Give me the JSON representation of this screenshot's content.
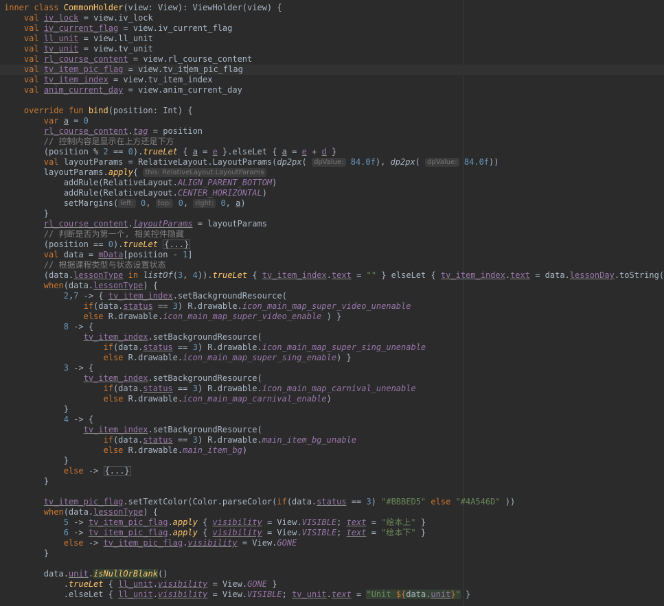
{
  "code": {
    "l1": {
      "a": "inner class ",
      "b": "CommonHolder",
      "c": "(view: View): ViewHolder(view) {"
    },
    "l2": {
      "a": "val ",
      "b": "iv_lock",
      "c": " = view.iv_lock"
    },
    "l3": {
      "a": "val ",
      "b": "iv_current_flag",
      "c": " = view.iv_current_flag"
    },
    "l4": {
      "a": "val ",
      "b": "ll_unit",
      "c": " = view.ll_unit"
    },
    "l5": {
      "a": "val ",
      "b": "tv_unit",
      "c": " = view.tv_unit"
    },
    "l6": {
      "a": "val ",
      "b": "rl_course_content",
      "c": " = view.rl_course_content"
    },
    "l7": {
      "a": "val ",
      "b": "tv_item_pic_flag",
      "c": " = view.tv_it",
      "d": "em_pic_flag"
    },
    "l8": {
      "a": "val ",
      "b": "tv_item_index",
      "c": " = view.tv_item_index"
    },
    "l9": {
      "a": "val ",
      "b": "anim_current_day",
      "c": " = view.anim_current_day"
    },
    "l11": {
      "a": "override fun ",
      "b": "bind",
      "c": "(position: Int) {"
    },
    "l12": {
      "a": "var ",
      "b": "a",
      "c": " = ",
      "d": "0"
    },
    "l13": {
      "a": "rl_course_content",
      "b": ".",
      "c": "tag",
      "d": " = position"
    },
    "l14": {
      "a": "// 控制内容是显示在上方还是下方"
    },
    "l15": {
      "a": "(position % ",
      "b": "2",
      "c": " == ",
      "d": "0",
      "e": ").",
      "f": "trueLet",
      "g": " { ",
      "h": "a",
      "i": " = ",
      "j": "e",
      "k": " }.elseLet { ",
      "l": "a",
      "m": " = ",
      "n": "e",
      "o": " + ",
      "p": "d",
      "q": " }"
    },
    "l16": {
      "a": "val ",
      "b": "layoutParams = RelativeLayout.LayoutParams(",
      "c": "dp2px",
      "d": "(",
      "e": "dpValue:",
      "f": " 84.0f",
      "g": "), ",
      "h": "dp2px",
      "i": "(",
      "j": "dpValue:",
      "k": " 84.0f",
      "l": "))"
    },
    "l17": {
      "a": "layoutParams.",
      "b": "apply",
      "c": "{",
      "d": "this: RelativeLayout.LayoutParams"
    },
    "l18": {
      "a": "addRule(RelativeLayout.",
      "b": "ALIGN_PARENT_BOTTOM",
      "c": ")"
    },
    "l19": {
      "a": "addRule(RelativeLayout.",
      "b": "CENTER_HORIZONTAL",
      "c": ")"
    },
    "l20": {
      "a": "setMargins(",
      "b": "left:",
      "c": " 0",
      "d": ", ",
      "e": "top:",
      "f": " 0",
      "g": ", ",
      "h": "right:",
      "i": " 0",
      "j": ", ",
      "k": "a",
      "l": ")"
    },
    "l21": {
      "a": "}"
    },
    "l22": {
      "a": "rl_course_content",
      "b": ".",
      "c": "layoutParams",
      "d": " = layoutParams"
    },
    "l23": {
      "a": "// 判断是否为第一个, 相关控件隐藏"
    },
    "l24": {
      "a": "(position == ",
      "b": "0",
      "c": ").",
      "d": "trueLet",
      "e": " ",
      "f": "{...}"
    },
    "l25": {
      "a": "val ",
      "b": "data = ",
      "c": "mData",
      "d": "[position - ",
      "e": "1",
      "f": "]"
    },
    "l26": {
      "a": "// 根据课程类型与状态设置状态"
    },
    "l27": {
      "a": "(data.",
      "b": "lessonType",
      "c": " ",
      "d": "in ",
      "e": "listOf",
      "f": "(",
      "g": "3",
      "h": ", ",
      "i": "4",
      "j": ")).",
      "k": "trueLet",
      "l": " { ",
      "m": "tv_item_index",
      "n": ".",
      "o": "text",
      "p": " = ",
      "q": "\"\"",
      "r": " } elseLet { ",
      "s": "tv_item_index",
      "t": ".",
      "u": "text",
      "v": " = data.",
      "w": "lessonDay",
      "x": ".toString() }"
    },
    "l28": {
      "a": "when",
      "b": "(data.",
      "c": "lessonType",
      "d": ") {"
    },
    "l29": {
      "a": "2",
      "b": ",",
      "c": "7",
      "d": " -> { ",
      "e": "tv_item_index",
      "f": ".setBackgroundResource("
    },
    "l30": {
      "a": "if",
      "b": "(data.",
      "c": "status",
      "d": " == ",
      "e": "3",
      "f": ") R.drawable.",
      "g": "icon_main_map_super_video_unenable"
    },
    "l31": {
      "a": "else ",
      "b": "R.drawable.",
      "c": "icon_main_map_super_video_enable",
      "d": " ) }"
    },
    "l32": {
      "a": "8",
      "b": " -> {"
    },
    "l33": {
      "a": "tv_item_index",
      "b": ".setBackgroundResource("
    },
    "l34": {
      "a": "if",
      "b": "(data.",
      "c": "status",
      "d": " == ",
      "e": "3",
      "f": ") R.drawable.",
      "g": "icon_main_map_super_sing_unenable"
    },
    "l35": {
      "a": "else ",
      "b": "R.drawable.",
      "c": "icon_main_map_super_sing_enable",
      "d": ") }"
    },
    "l36": {
      "a": "3",
      "b": " -> {"
    },
    "l37": {
      "a": "tv_item_index",
      "b": ".setBackgroundResource("
    },
    "l38": {
      "a": "if",
      "b": "(data.",
      "c": "status",
      "d": " == ",
      "e": "3",
      "f": ") R.drawable.",
      "g": "icon_main_map_carnival_unenable"
    },
    "l39": {
      "a": "else ",
      "b": "R.drawable.",
      "c": "icon_main_map_carnival_enable",
      "d": ")"
    },
    "l40": {
      "a": "}"
    },
    "l41": {
      "a": "4",
      "b": " -> {"
    },
    "l42": {
      "a": "tv_item_index",
      "b": ".setBackgroundResource("
    },
    "l43": {
      "a": "if",
      "b": "(data.",
      "c": "status",
      "d": " == ",
      "e": "3",
      "f": ") R.drawable.",
      "g": "main_item_bg_unable"
    },
    "l44": {
      "a": "else ",
      "b": "R.drawable.",
      "c": "main_item_bg",
      "d": ")"
    },
    "l45": {
      "a": "}"
    },
    "l46": {
      "a": "else",
      "b": " -> ",
      "c": "{...}"
    },
    "l47": {
      "a": "}"
    },
    "l49": {
      "a": "tv_item_pic_flag",
      "b": ".setTextColor(Color.parseColor(",
      "c": "if",
      "d": "(data.",
      "e": "status",
      "f": " == ",
      "g": "3",
      "h": ") ",
      "i": "\"#BBBED5\"",
      "j": " ",
      "k": "else ",
      "l": "\"#4A546D\"",
      "m": " ))"
    },
    "l50": {
      "a": "when",
      "b": "(data.",
      "c": "lessonType",
      "d": ") {"
    },
    "l51": {
      "a": "5",
      "b": " -> ",
      "c": "tv_item_pic_flag",
      "d": ".",
      "e": "apply",
      "f": " { ",
      "g": "visibility",
      "h": " = View.",
      "i": "VISIBLE",
      "j": "; ",
      "k": "text",
      "l": " = ",
      "m": "\"绘本上\"",
      "n": " }"
    },
    "l52": {
      "a": "6",
      "b": " -> ",
      "c": "tv_item_pic_flag",
      "d": ".",
      "e": "apply",
      "f": " { ",
      "g": "visibility",
      "h": " = View.",
      "i": "VISIBLE",
      "j": "; ",
      "k": "text",
      "l": " = ",
      "m": "\"绘本下\"",
      "n": " }"
    },
    "l53": {
      "a": "else",
      "b": " -> ",
      "c": "tv_item_pic_flag",
      "d": ".",
      "e": "visibility",
      "f": " = View.",
      "g": "GONE"
    },
    "l54": {
      "a": "}"
    },
    "l56": {
      "a": "data.",
      "b": "unit",
      "c": ".",
      "d": "isNullOrBlank",
      "e": "()"
    },
    "l57": {
      "a": ".",
      "b": "trueLet",
      "c": " { ",
      "d": "ll_unit",
      "e": ".",
      "f": "visibility",
      "g": " = View.",
      "h": "GONE",
      "i": " }"
    },
    "l58": {
      "a": ".elseLet { ",
      "b": "ll_unit",
      "c": ".",
      "d": "visibility",
      "e": " = View.",
      "f": "VISIBLE",
      "g": "; ",
      "h": "tv_unit",
      "i": ".",
      "j": "text",
      "k": " = ",
      "l": "\"Unit ",
      "m": "${",
      "n": "data.",
      "o": "unit",
      "p": "}",
      "q": "\"",
      "r": " }"
    }
  },
  "colors": {
    "background": "#2b2b2b",
    "keyword": "#cc7832",
    "function": "#ffc66d",
    "property": "#9876aa",
    "number": "#6897bb",
    "string": "#6a8759",
    "comment": "#808080"
  }
}
